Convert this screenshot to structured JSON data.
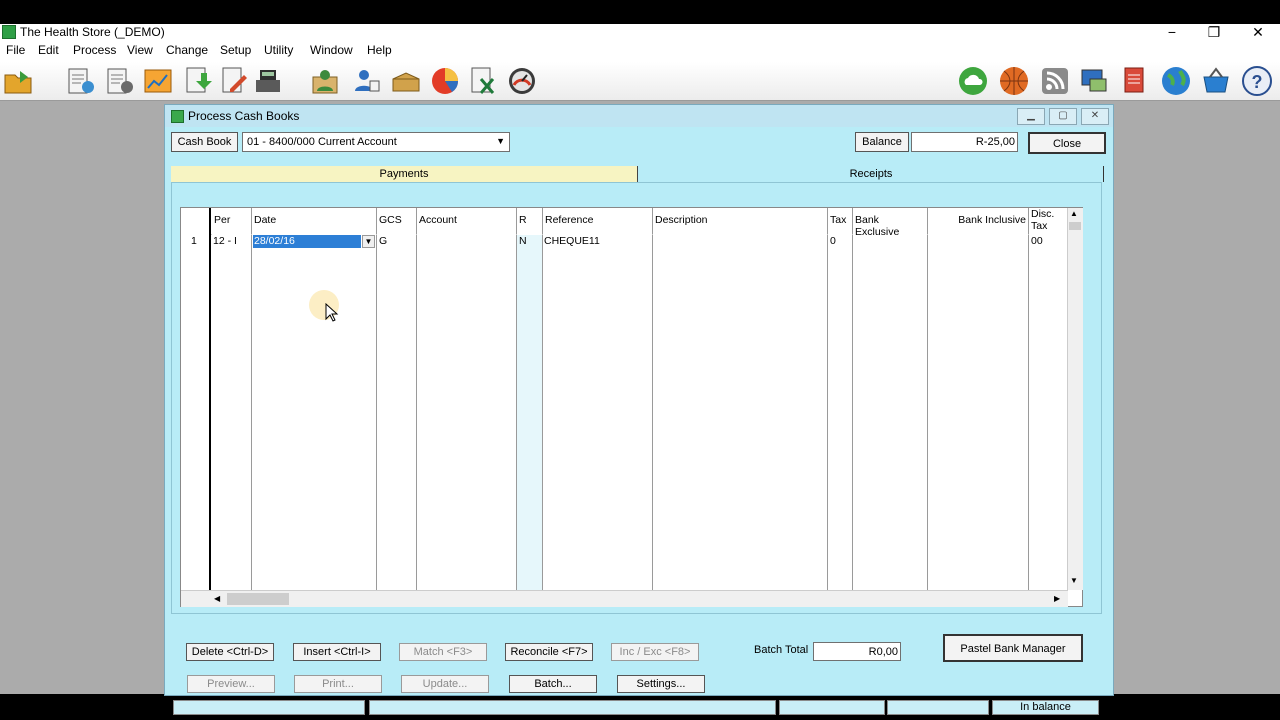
{
  "app": {
    "title": "The Health Store (_DEMO)",
    "window_controls": {
      "minimize": "−",
      "restore": "❐",
      "close": "✕"
    }
  },
  "menu": [
    "File",
    "Edit",
    "Process",
    "View",
    "Change",
    "Setup",
    "Utility",
    "Window",
    "Help"
  ],
  "toolbar": {
    "left_icons": [
      "open-company-icon",
      "customer-document-icon",
      "supplier-document-icon",
      "chart-report-icon",
      "import-export-icon",
      "edit-document-icon",
      "cash-register-icon",
      "customer-user-icon",
      "supplier-user-icon",
      "inventory-box-icon",
      "pie-chart-icon",
      "excel-icon",
      "dashboard-gauge-icon"
    ],
    "right_icons": [
      "cloud-sync-icon",
      "basketball-icon",
      "rss-feed-icon",
      "network-computer-icon",
      "report-writer-icon",
      "web-globe-icon",
      "basket-icon",
      "help-icon"
    ]
  },
  "window": {
    "title": "Process Cash Books",
    "cash_book_label": "Cash Book",
    "cash_book_value": "01 -  8400/000 Current Account",
    "balance_label": "Balance",
    "balance_value": "R-25,00",
    "close_label": "Close",
    "tabs": {
      "payments": "Payments",
      "receipts": "Receipts"
    },
    "grid": {
      "headers": {
        "per": "Per",
        "date": "Date",
        "gcs": "GCS",
        "account": "Account",
        "r": "R",
        "reference": "Reference",
        "description": "Description",
        "tax": "Tax",
        "bank_exclusive": "Bank Exclusive",
        "bank_inclusive": "Bank Inclusive",
        "disc_tax_1": "Disc.",
        "disc_tax_2": "Tax"
      },
      "row1": {
        "num": "1",
        "per": "12 - I",
        "date": "28/02/16",
        "gcs": "G",
        "account": "",
        "r": "N",
        "reference": "CHEQUE11",
        "description": "",
        "tax": "0",
        "bank_exclusive": "",
        "bank_inclusive": "",
        "disc_tax": "00"
      }
    },
    "buttons": {
      "delete": "Delete <Ctrl-D>",
      "insert": "Insert <Ctrl-I>",
      "match": "Match <F3>",
      "reconcile": "Reconcile <F7>",
      "inc_exc": "Inc / Exc <F8>",
      "preview": "Preview...",
      "print": "Print...",
      "update": "Update...",
      "batch": "Batch...",
      "settings": "Settings...",
      "bank_manager": "Pastel Bank Manager"
    },
    "batch_total_label": "Batch Total",
    "batch_total_value": "R0,00",
    "status": {
      "in_balance": "In balance"
    }
  }
}
